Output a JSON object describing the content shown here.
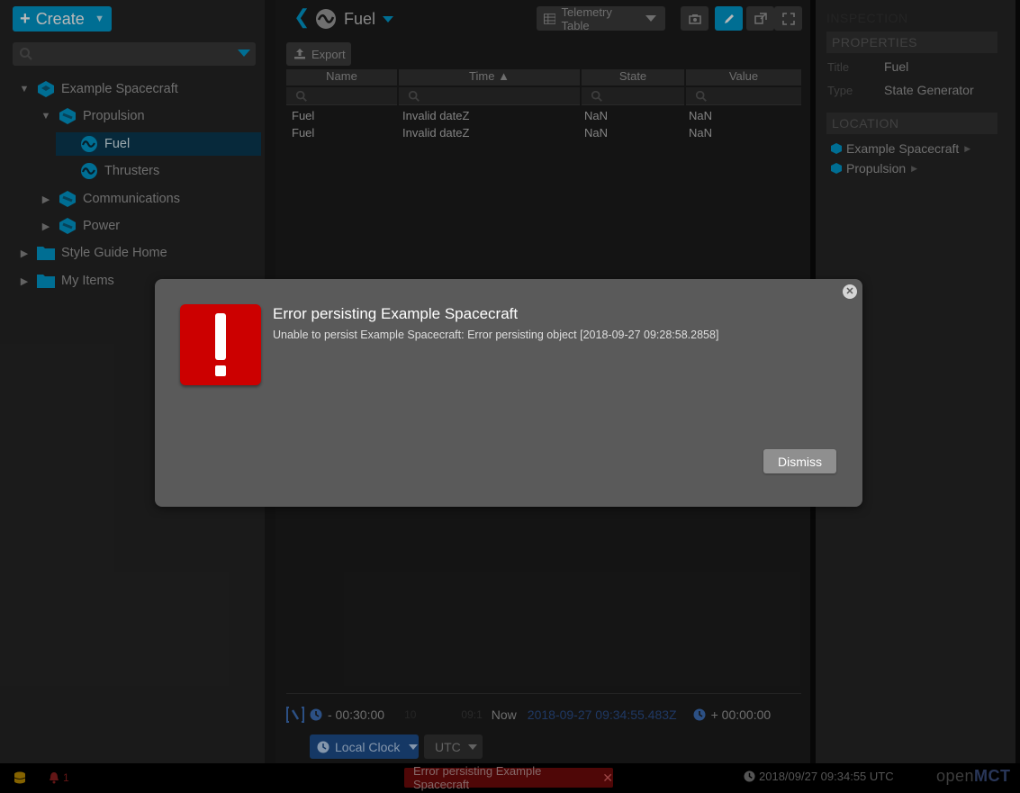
{
  "left_panel": {
    "create_label": "Create",
    "tree": [
      {
        "label": "Example Spacecraft",
        "arrow": "▼"
      },
      {
        "label": "Propulsion",
        "arrow": "▼"
      },
      {
        "label": "Fuel",
        "arrow": ""
      },
      {
        "label": "Thrusters",
        "arrow": ""
      },
      {
        "label": "Communications",
        "arrow": "▶"
      },
      {
        "label": "Power",
        "arrow": "▶"
      },
      {
        "label": "Style Guide Home",
        "arrow": "▶"
      },
      {
        "label": "My Items",
        "arrow": "▶"
      }
    ]
  },
  "center": {
    "object_title": "Fuel",
    "view_label": "Telemetry Table",
    "export_label": "Export",
    "columns": [
      "Name",
      "Time ▲",
      "State",
      "Value"
    ],
    "rows": [
      [
        "Fuel",
        "Invalid dateZ",
        "NaN",
        "NaN"
      ],
      [
        "Fuel",
        "Invalid dateZ",
        "NaN",
        "NaN"
      ]
    ],
    "time_conductor": {
      "start_offset": "- 00:30:00",
      "tick_left": "10",
      "tick_right": "09:1",
      "now_label": "Now",
      "now_value": "2018-09-27 09:34:55.483Z",
      "end_offset": "+ 00:00:00",
      "clock_label": "Local Clock",
      "timezone_label": "UTC"
    }
  },
  "inspector": {
    "header": "INSPECTION",
    "properties_header": "PROPERTIES",
    "properties": [
      {
        "label": "Title",
        "value": "Fuel"
      },
      {
        "label": "Type",
        "value": "State Generator"
      }
    ],
    "location_header": "LOCATION",
    "location": [
      "Example Spacecraft",
      "Propulsion"
    ]
  },
  "status_bar": {
    "alert_count": "1",
    "notification": "Error persisting Example Spacecraft",
    "clock": "2018/09/27 09:34:55 UTC",
    "logo_open": "open",
    "logo_mct": "MCT"
  },
  "dialog": {
    "title": "Error persisting Example Spacecraft",
    "message": "Unable to persist Example Spacecraft: Error persisting object [2018-09-27 09:28:58.2858]",
    "dismiss_label": "Dismiss"
  },
  "colors": {
    "accent": "#0099cc",
    "error": "#cc0000",
    "dialog_bg": "#5a5a5a"
  }
}
